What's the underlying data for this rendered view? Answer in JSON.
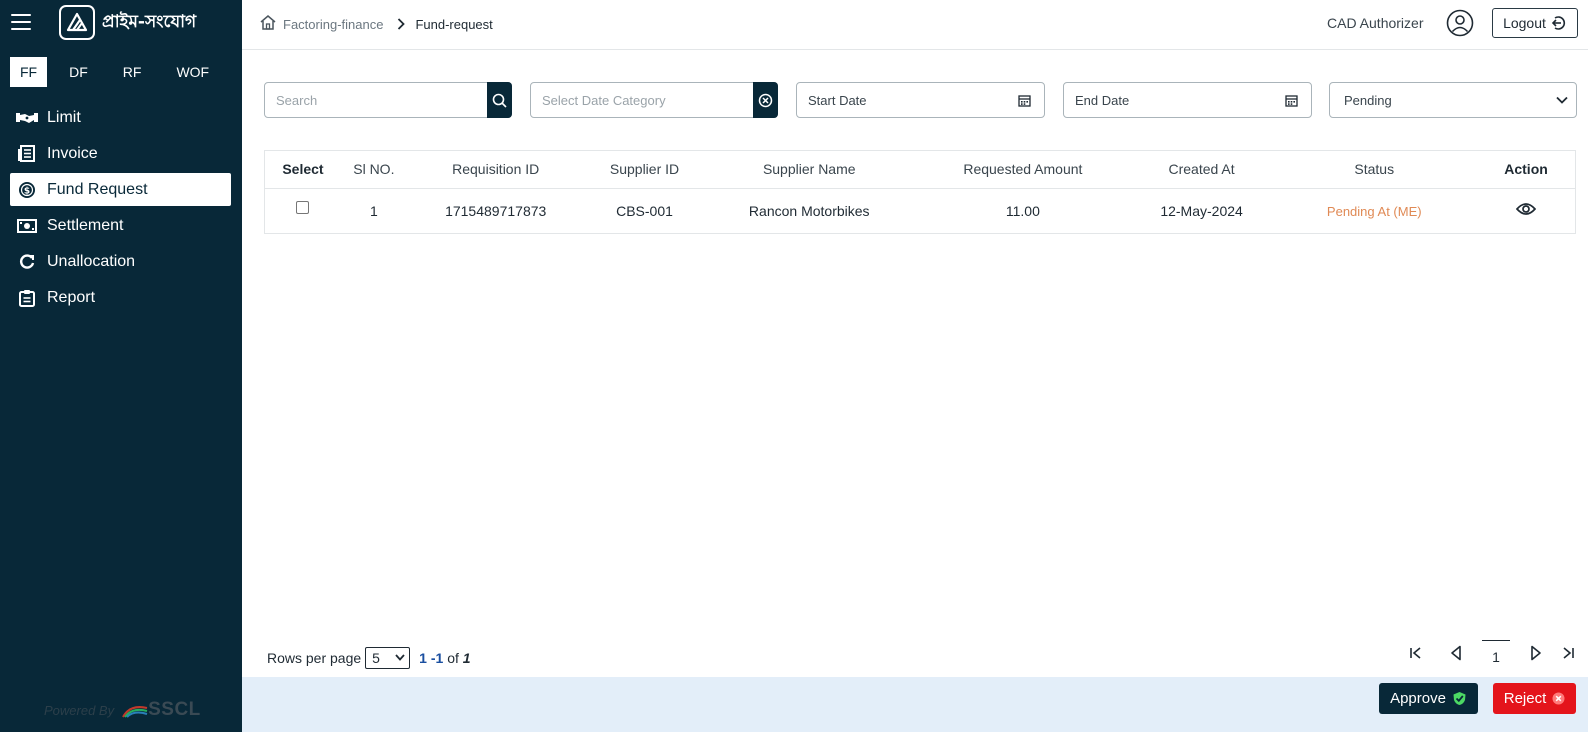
{
  "app": {
    "brand_name": "প্রাইম-সংযোগ",
    "powered_by": "Powered By",
    "powered_brand": "SSCL"
  },
  "sidebar": {
    "mode_tabs": [
      {
        "label": "FF",
        "active": true
      },
      {
        "label": "DF",
        "active": false
      },
      {
        "label": "RF",
        "active": false
      },
      {
        "label": "WOF",
        "active": false
      }
    ],
    "items": [
      {
        "label": "Limit",
        "icon": "handshake-icon"
      },
      {
        "label": "Invoice",
        "icon": "invoice-icon"
      },
      {
        "label": "Fund Request",
        "icon": "dollar-circle-icon",
        "active": true
      },
      {
        "label": "Settlement",
        "icon": "money-icon"
      },
      {
        "label": "Unallocation",
        "icon": "refresh-icon"
      },
      {
        "label": "Report",
        "icon": "clipboard-icon"
      }
    ]
  },
  "header": {
    "breadcrumb": {
      "parent": "Factoring-finance",
      "current": "Fund-request"
    },
    "user_role": "CAD Authorizer",
    "logout_label": "Logout"
  },
  "filters": {
    "search_placeholder": "Search",
    "date_category_placeholder": "Select Date Category",
    "start_date_placeholder": "Start Date",
    "end_date_placeholder": "End Date",
    "status_selected": "Pending"
  },
  "table": {
    "columns": [
      "Select",
      "Sl NO.",
      "Requisition ID",
      "Supplier ID",
      "Supplier Name",
      "Requested Amount",
      "Created At",
      "Status",
      "Action"
    ],
    "rows": [
      {
        "sl_no": "1",
        "requisition_id": "1715489717873",
        "supplier_id": "CBS-001",
        "supplier_name": "Rancon Motorbikes",
        "requested_amount": "11.00",
        "created_at": "12-May-2024",
        "status": "Pending At (ME)"
      }
    ]
  },
  "pagination": {
    "rows_per_page_label": "Rows per page",
    "rows_per_page_value": "5",
    "range_start": "1",
    "range_end": "-1",
    "range_of": "of",
    "total": "1",
    "current_page": "1"
  },
  "footer": {
    "approve_label": "Approve",
    "reject_label": "Reject"
  },
  "colors": {
    "sidebar_bg": "#082838",
    "status_pending": "#e08a55",
    "reject": "#e4141b",
    "approve_check": "#4cd964",
    "footer_bg": "#e3eef9"
  }
}
